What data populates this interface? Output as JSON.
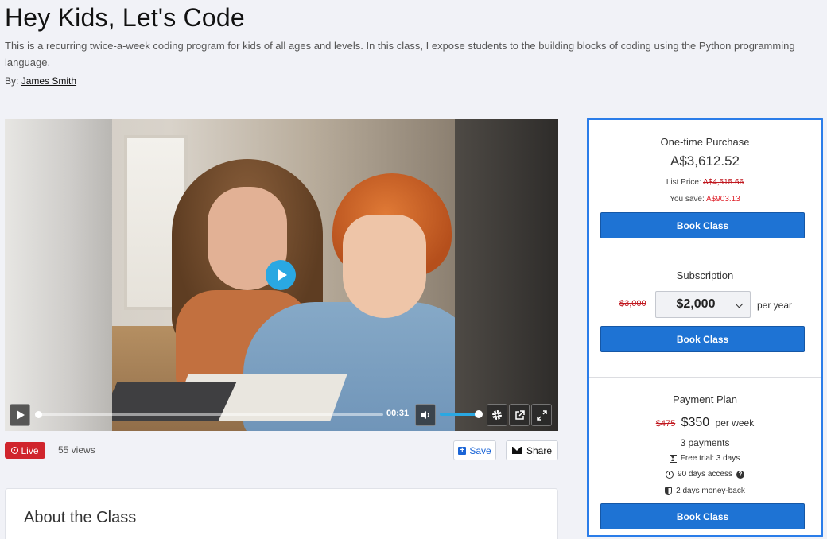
{
  "page": {
    "title": "Hey Kids, Let's Code",
    "description": "This is a recurring twice-a-week coding program for kids of all ages and levels. In this class, I expose students to the building blocks of coding using the Python programming language.",
    "by_label": "By:",
    "author": "James Smith"
  },
  "video": {
    "time": "00:31",
    "progress": 0.0,
    "volume": 1.0,
    "controls": [
      "play-icon",
      "speaker-icon",
      "gear-icon",
      "popout-icon",
      "fullscreen-icon"
    ]
  },
  "meta": {
    "live_label": "Live",
    "views": "55 views",
    "save_label": "Save",
    "share_label": "Share"
  },
  "about": {
    "heading": "About the Class"
  },
  "pricing": {
    "one_time": {
      "title": "One-time Purchase",
      "price": "A$3,612.52",
      "list_label": "List Price:",
      "list_price": "A$4,515.66",
      "save_label": "You save:",
      "save_amount": "A$903.13",
      "button": "Book Class"
    },
    "subscription": {
      "title": "Subscription",
      "old_price": "$3,000",
      "selected_price": "$2,000",
      "period": "per year",
      "button": "Book Class"
    },
    "payment_plan": {
      "title": "Payment Plan",
      "old_price": "$475",
      "price": "$350",
      "period": "per week",
      "payments": "3 payments",
      "trial": "Free trial: 3 days",
      "access": "90 days access",
      "moneyback": "2 days money-back",
      "button": "Book Class"
    }
  },
  "colors": {
    "accent": "#1e73d4",
    "panel_border": "#2b7de9",
    "live": "#d0252d",
    "discount": "#e0242d",
    "play": "#2aa8e2"
  }
}
